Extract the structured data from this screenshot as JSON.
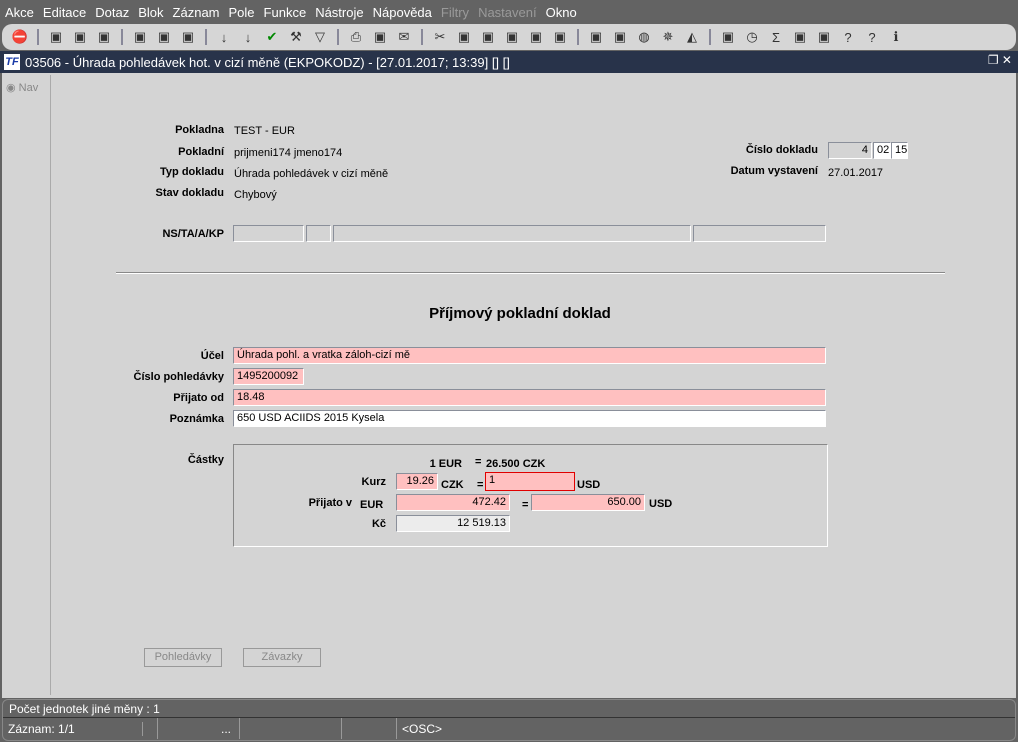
{
  "menu": [
    "Akce",
    "Editace",
    "Dotaz",
    "Blok",
    "Záznam",
    "Pole",
    "Funkce",
    "Nástroje",
    "Nápověda",
    "Filtry",
    "Nastavení",
    "Okno"
  ],
  "menu_disabled": [
    "Filtry",
    "Nastavení"
  ],
  "toolbar": [
    "exit-icon",
    "insert-record-icon",
    "save-record-icon",
    "delete-record-icon",
    "query-icon",
    "execute-query-icon",
    "cancel-query-icon",
    "sort-asc-icon",
    "sort-desc-icon",
    "check-icon",
    "wrench-icon",
    "filter-icon",
    "print-icon",
    "print-setup-icon",
    "mail-icon",
    "cut-icon",
    "copy-icon",
    "paste-icon",
    "edit-icon",
    "list-icon",
    "tree-icon",
    "calc-icon",
    "doc-icon",
    "globe-icon",
    "wheel-icon",
    "eye-icon",
    "report-icon",
    "clock-icon",
    "sum-icon",
    "excel-icon",
    "ie-icon",
    "help-context-icon",
    "help-icon",
    "info-icon"
  ],
  "window": {
    "title": "03506 - Úhrada pohledávek hot. v cizí měně (EKPOKODZ) - [27.01.2017; 13:39]  [] []",
    "logo": "TF"
  },
  "nav": {
    "label": "Nav"
  },
  "header": {
    "pokladna_label": "Pokladna",
    "pokladna": "TEST - EUR",
    "pokladni_label": "Pokladní",
    "pokladni": "prijmeni174 jmeno174",
    "typ_label": "Typ dokladu",
    "typ": "Úhrada pohledávek v cizí měně",
    "stav_label": "Stav dokladu",
    "stav": "Chybový",
    "cislo_label": "Číslo dokladu",
    "cislo": [
      "4",
      "02",
      "15"
    ],
    "datum_label": "Datum vystavení",
    "datum": "27.01.2017",
    "ns_label": "NS/TA/A/KP"
  },
  "form": {
    "title": "Příjmový pokladní doklad",
    "ucel_label": "Účel",
    "ucel": "Úhrada pohl. a vratka záloh-cizí mě",
    "cislo_pohl_label": "Číslo pohledávky",
    "cislo_pohl": "1495200092",
    "prijato_od_label": "Přijato od",
    "prijato_od": "18.48",
    "poznamka_label": "Poznámka",
    "poznamka": "650 USD ACIIDS 2015 Kysela"
  },
  "castky": {
    "label": "Částky",
    "rate_left": "1 EUR",
    "rate_eq": "=",
    "rate_right": "26.500 CZK",
    "kurz_label": "Kurz",
    "kurz": "19.26",
    "czk": "CZK",
    "eq": "=",
    "kurz_usd": "1",
    "usd": "USD",
    "prijato_v_label": "Přijato v",
    "eur": "EUR",
    "eur_val": "472.42",
    "usd_val": "650.00",
    "kc_label": "Kč",
    "kc_val": "12 519.13"
  },
  "buttons": {
    "pohledavky": "Pohledávky",
    "zavazky": "Závazky"
  },
  "status": {
    "message": "Počet jednotek jiné měny : 1",
    "record": "Záznam: 1/1",
    "ellipsis": "...",
    "mode": "<OSC>"
  }
}
